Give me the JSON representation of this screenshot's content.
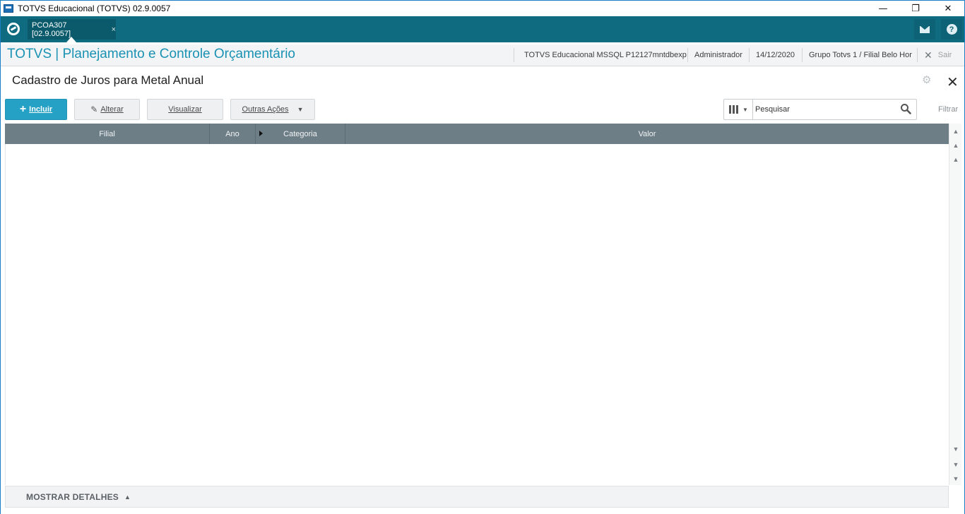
{
  "window": {
    "title": "TOTVS Educacional (TOTVS) 02.9.0057",
    "minimize": "—",
    "restore": "❐",
    "close": "✕"
  },
  "topbar": {
    "tab_label": "PCOA307 [02.9.0057]",
    "tab_close": "×",
    "help_label": "?"
  },
  "module": {
    "title": "TOTVS | Planejamento e Controle Orçamentário",
    "environment": "TOTVS Educacional MSSQL P12127mntdbexp",
    "user": "Administrador",
    "date": "14/12/2020",
    "branch": "Grupo Totvs 1 / Filial Belo Hor",
    "exit_label": "Sair"
  },
  "page": {
    "title": "Cadastro de Juros para Metal Anual"
  },
  "toolbar": {
    "include_label": "Incluir",
    "edit_label": "Alterar",
    "view_label": "Visualizar",
    "other_actions_label": "Outras Ações"
  },
  "search": {
    "placeholder": "Pesquisar",
    "filter_label": "Filtrar"
  },
  "grid": {
    "columns": [
      "Filial",
      "Ano",
      "Categoria",
      "Valor"
    ],
    "rows": []
  },
  "details": {
    "label": "MOSTRAR DETALHES"
  }
}
